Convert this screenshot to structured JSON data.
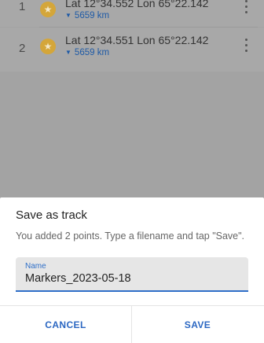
{
  "markers": [
    {
      "index": "1",
      "icon": "star-icon",
      "coords": "Lat 12°34.552 Lon 65°22.142",
      "distance": "5659 km"
    },
    {
      "index": "2",
      "icon": "star-icon",
      "coords": "Lat 12°34.551 Lon 65°22.142",
      "distance": "5659 km"
    }
  ],
  "dialog": {
    "title": "Save as track",
    "message": "You added 2 points. Type a filename and tap \"Save\".",
    "field_label": "Name",
    "field_value": "Markers_2023-05-18",
    "cancel_label": "CANCEL",
    "save_label": "SAVE"
  },
  "colors": {
    "accent": "#2b67c2",
    "marker_star": "#d4a63a",
    "scrim": "#a3a3a3"
  }
}
